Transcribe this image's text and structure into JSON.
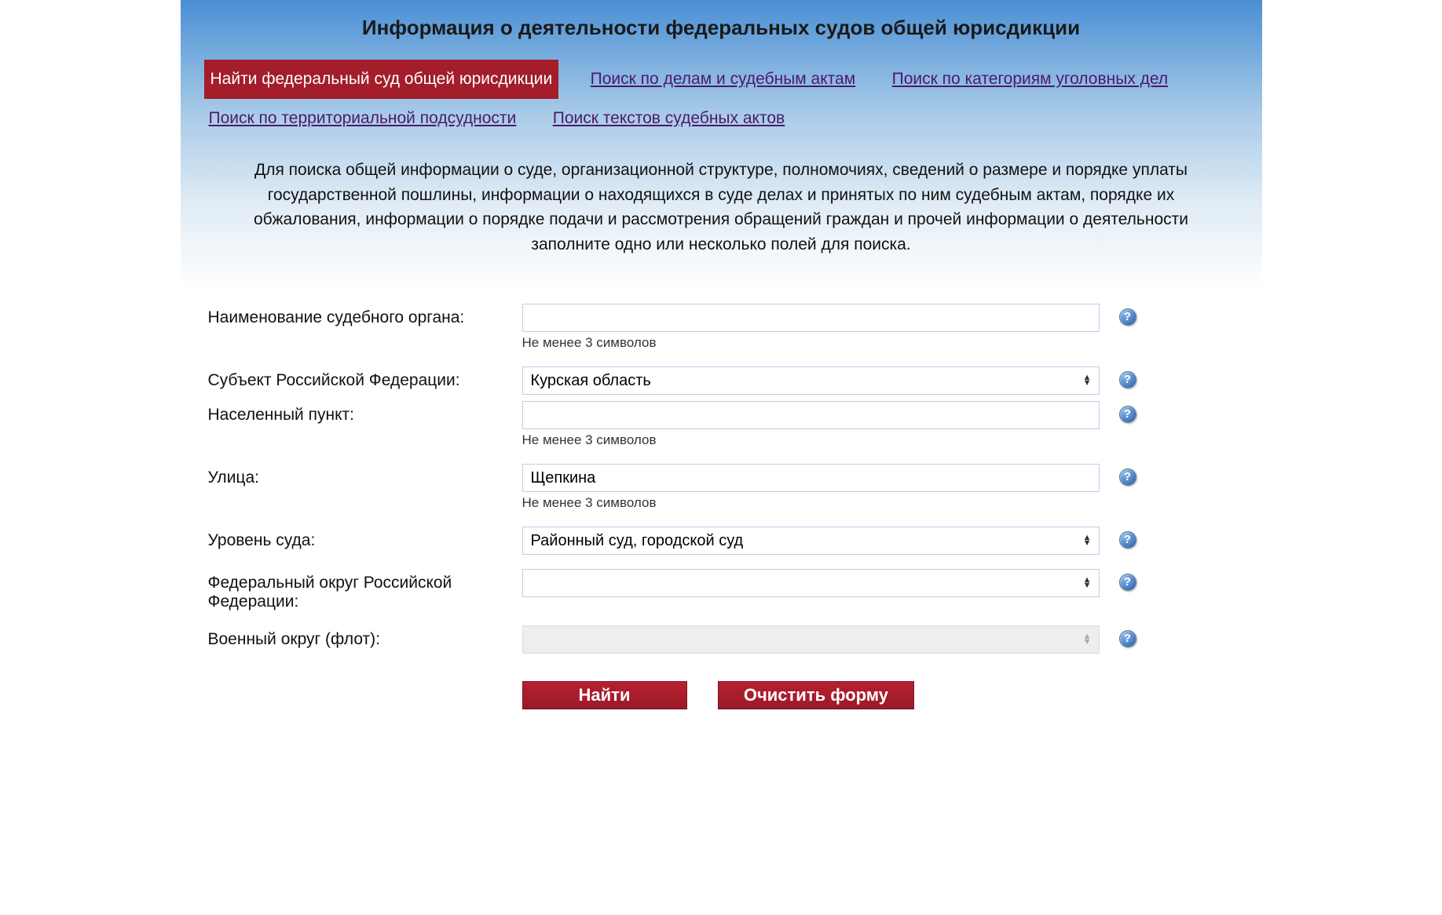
{
  "page_title": "Информация о деятельности федеральных судов общей юрисдикции",
  "tabs": [
    {
      "label": "Найти федеральный суд общей юрисдикции",
      "active": true
    },
    {
      "label": "Поиск по делам и судебным актам",
      "active": false
    },
    {
      "label": "Поиск по категориям уголовных дел",
      "active": false
    },
    {
      "label": "Поиск по территориальной подсудности",
      "active": false
    },
    {
      "label": "Поиск текстов судебных актов",
      "active": false
    }
  ],
  "description": "Для поиска общей информации о суде, организационной структуре, полномочиях, сведений о размере и порядке уплаты государственной пошлины, информации о находящихся в суде делах и принятых по ним судебным актам, порядке их обжалования, информации о порядке подачи и рассмотрения обращений граждан и прочей информации о деятельности заполните одно или несколько полей для поиска.",
  "hint_text": "Не менее 3 символов",
  "fields": {
    "court_name": {
      "label": "Наименование судебного органа:",
      "value": ""
    },
    "subject": {
      "label": "Субъект Российской Федерации:",
      "value": "Курская область"
    },
    "locality": {
      "label": "Населенный пункт:",
      "value": ""
    },
    "street": {
      "label": "Улица:",
      "value": "Щепкина"
    },
    "court_level": {
      "label": "Уровень суда:",
      "value": "Районный суд, городской суд"
    },
    "federal_district": {
      "label": "Федеральный округ Российской Федерации:",
      "value": ""
    },
    "military_district": {
      "label": "Военный округ (флот):",
      "value": "",
      "disabled": true
    }
  },
  "buttons": {
    "search": "Найти",
    "clear": "Очистить форму"
  },
  "colors": {
    "accent": "#a31d2a",
    "link": "#4b1a6a",
    "gradient_top": "#4a8fd4"
  }
}
